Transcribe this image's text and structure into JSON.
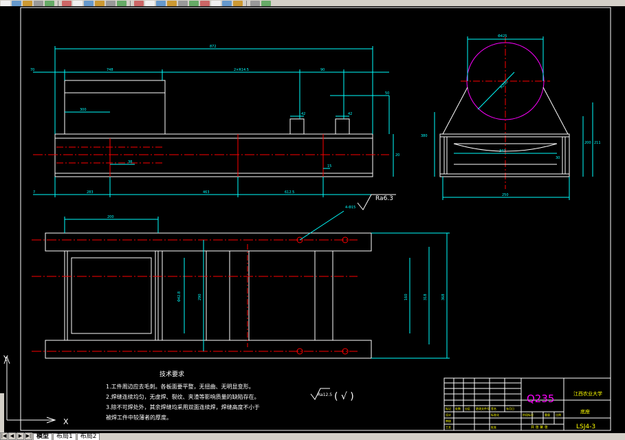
{
  "toolbar": {
    "buttons": [
      "new-file-icon",
      "open-icon",
      "save-icon",
      "print-icon",
      "preview-icon",
      "cut-icon",
      "copy-icon",
      "paste-icon",
      "match-properties-icon",
      "undo-icon",
      "redo-icon",
      "hyperlink-icon",
      "pan-icon",
      "zoom-realtime-icon",
      "zoom-window-icon",
      "zoom-previous-icon",
      "properties-icon",
      "design-center-icon",
      "tool-palettes-icon",
      "calculator-icon",
      "help-icon",
      "layer-icon",
      "layer-state-icon"
    ],
    "colors": {
      "bg": "#d4d0c8",
      "dark": "#808080"
    }
  },
  "drawing": {
    "colors": {
      "outline": "#ffffff",
      "dimension": "#00ffff",
      "center": "#ff0000",
      "circle": "#ff00ff",
      "text": "#ffffff",
      "border": "#ffffff"
    },
    "front_view_dims": {
      "overall": "872",
      "left_offset": "70",
      "seg1": "748",
      "seg2": "2×R14.5",
      "seg3": "90",
      "hole_gap": "42",
      "hole_gap2": "42",
      "slot_w": "300",
      "side_h": "50",
      "height": "20",
      "small": "38",
      "bottom_left": "7",
      "b1": "283",
      "b2": "463",
      "b3": "612.5",
      "small2": "15"
    },
    "side_view_dims": {
      "top": "Φ425",
      "diag": "R200",
      "inner": "347",
      "bottom": "250",
      "right_h": "200",
      "right_h2": "211",
      "left_h": "380",
      "slot": "30"
    },
    "top_view_dims": {
      "top_w": "200",
      "inner_h": "Φ42.8",
      "mid_h": "290",
      "r_h1": "160",
      "r_h2": "318",
      "r_h3": "368"
    },
    "roughness_main": "Ra6.3",
    "roughness_leader": "4-Φ15",
    "roughness_general": "Ra12.5",
    "roughness_bracket": "( √ )",
    "tech_requirements": {
      "title": "技术要求",
      "items": [
        "1.工件周边应去毛刺。各板面要平整，无扭曲、无明显变形。",
        "2.焊缝连续均匀，无虚焊、裂纹、夹渣等影响质量的缺陷存在。",
        "3.除不可焊处外，其余焊缝均采用双面连续焊，焊缝高度不小于",
        "  被焊工件中较薄者的厚度。"
      ]
    },
    "title_block": {
      "material": "Q235",
      "school": "江西农业大学",
      "part_name": "底座",
      "drawing_no": "LSJ4-3",
      "row_labels": [
        "标记",
        "处数",
        "分区",
        "更改文件号",
        "签名",
        "年月日"
      ],
      "labels2": [
        "设计",
        "标准化",
        "阶段标记",
        "重量",
        "比例"
      ],
      "labels3": [
        "审核",
        "工艺",
        "批准"
      ],
      "sheet_text": "共 张 第 张"
    }
  },
  "ucs": {
    "y_label": "Y",
    "x_label": "X"
  },
  "layout_tabs": [
    "模型",
    "布局1",
    "布局2"
  ]
}
